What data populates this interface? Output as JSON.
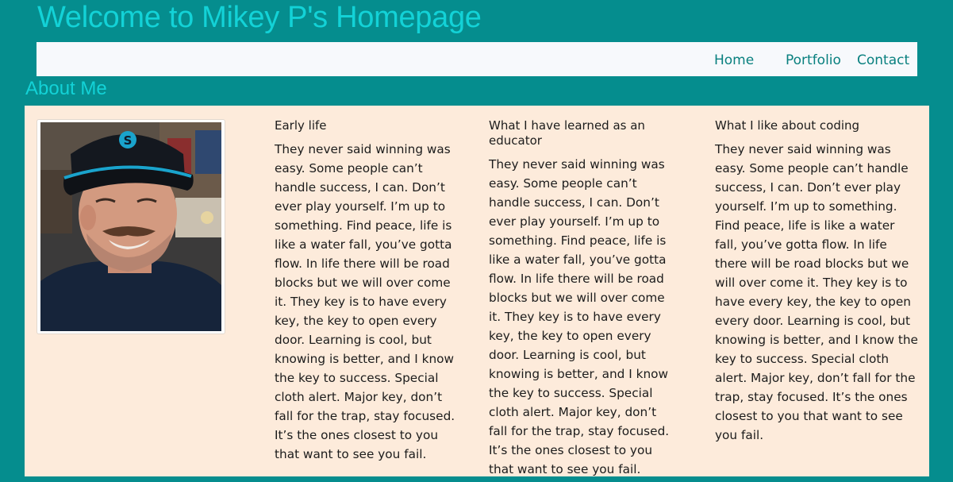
{
  "header": {
    "title": "Welcome to Mikey P's Homepage"
  },
  "nav": {
    "items": [
      {
        "label": "Home"
      },
      {
        "label": "Portfolio"
      },
      {
        "label": "Contact"
      }
    ]
  },
  "about": {
    "title": "About Me",
    "photo_alt": "profile-photo",
    "columns": [
      {
        "heading": "Early life",
        "text": "They never said winning was easy. Some people can’t handle success, I can. Don’t ever play yourself. I’m up to something. Find peace, life is like a water fall, you’ve gotta flow. In life there will be road blocks but we will over come it. They key is to have every key, the key to open every door. Learning is cool, but knowing is better, and I know the key to success. Special cloth alert. Major key, don’t fall for the trap, stay focused. It’s the ones closest to you that want to see you fail."
      },
      {
        "heading": "What I have learned as an educator",
        "text": "They never said winning was easy. Some people can’t handle success, I can. Don’t ever play yourself. I’m up to something. Find peace, life is like a water fall, you’ve gotta flow. In life there will be road blocks but we will over come it. They key is to have every key, the key to open every door. Learning is cool, but knowing is better, and I know the key to success. Special cloth alert. Major key, don’t fall for the trap, stay focused. It’s the ones closest to you that want to see you fail."
      },
      {
        "heading": "What I like about coding",
        "text": "They never said winning was easy. Some people can’t handle success, I can. Don’t ever play yourself. I’m up to something. Find peace, life is like a water fall, you’ve gotta flow. In life there will be road blocks but we will over come it. They key is to have every key, the key to open every door. Learning is cool, but knowing is better, and I know the key to success. Special cloth alert. Major key, don’t fall for the trap, stay focused. It’s the ones closest to you that want to see you fail."
      }
    ]
  },
  "colors": {
    "page_background": "#058d8e",
    "title_color": "#13d2d7",
    "nav_background": "#f7f9fc",
    "nav_link_color": "#09807f",
    "panel_background": "#fdebdb"
  }
}
